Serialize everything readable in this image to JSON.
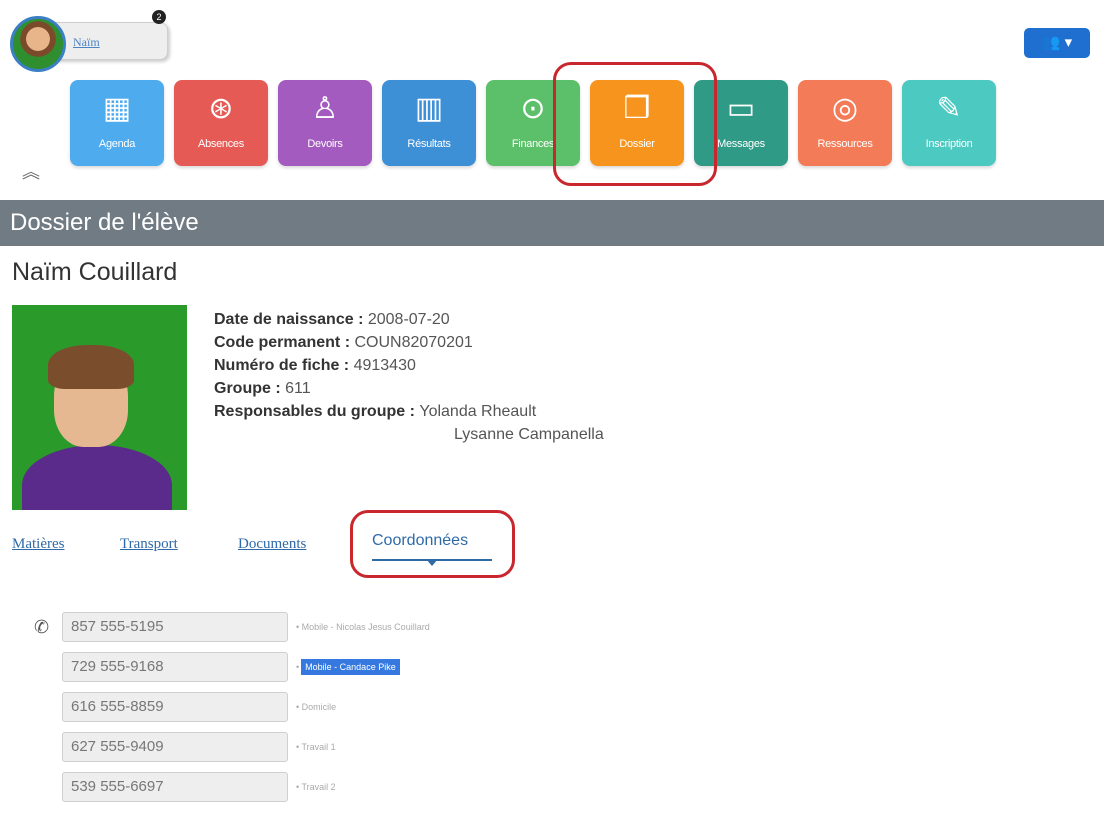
{
  "user": {
    "name_link": "Naïm",
    "notifications": "2"
  },
  "group_button_icon": "group-icon",
  "tiles": [
    {
      "label": "Agenda",
      "icon": "calendar-icon",
      "color": "#4dabee"
    },
    {
      "label": "Absences",
      "icon": "absences-icon",
      "color": "#e65a56"
    },
    {
      "label": "Devoirs",
      "icon": "devoirs-icon",
      "color": "#a45bc0"
    },
    {
      "label": "Résultats",
      "icon": "chart-icon",
      "color": "#3d8fd6"
    },
    {
      "label": "Finances",
      "icon": "money-icon",
      "color": "#5cbf6a"
    },
    {
      "label": "Dossier",
      "icon": "folder-icon",
      "color": "#f7941d"
    },
    {
      "label": "Messages",
      "icon": "message-icon",
      "color": "#2f9a86"
    },
    {
      "label": "Ressources",
      "icon": "resources-icon",
      "color": "#f37b57"
    },
    {
      "label": "Inscription",
      "icon": "inscription-icon",
      "color": "#4cc9c1"
    }
  ],
  "section_title": "Dossier de l'élève",
  "student": {
    "name": "Naïm Couillard",
    "fields": [
      {
        "label": "Date de naissance",
        "value": "2008-07-20"
      },
      {
        "label": "Code permanent",
        "value": "COUN82070201"
      },
      {
        "label": "Numéro de fiche",
        "value": "4913430"
      },
      {
        "label": "Groupe",
        "value": "611"
      },
      {
        "label": "Responsables du groupe",
        "value": "Yolanda Rheault"
      }
    ],
    "extra_responsable": "Lysanne Campanella"
  },
  "tabs": [
    "Matières",
    "Transport",
    "Documents",
    "Coordonnées"
  ],
  "active_tab": "Coordonnées",
  "phones": [
    {
      "number": "857 555-5195",
      "label": "• Mobile - Nicolas Jesus Couillard"
    },
    {
      "number": "729 555-9168",
      "label": "Mobile - Candace Pike"
    },
    {
      "number": "616 555-8859",
      "label": "• Domicile"
    },
    {
      "number": "627 555-9409",
      "label": "• Travail 1"
    },
    {
      "number": "539 555-6697",
      "label": "• Travail 2"
    }
  ]
}
